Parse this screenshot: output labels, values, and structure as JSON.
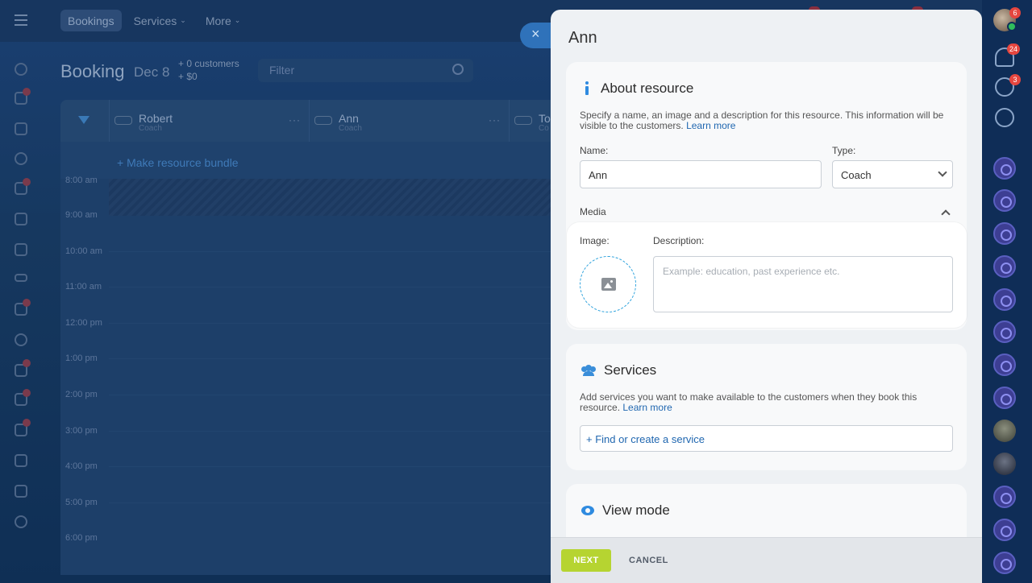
{
  "topnav": {
    "items": [
      {
        "label": "Bookings"
      },
      {
        "label": "Services"
      },
      {
        "label": "More"
      }
    ]
  },
  "booking": {
    "title": "Booking",
    "date": "Dec 8",
    "customers": "+ 0 customers",
    "amount": "+ $0",
    "filter_placeholder": "Filter"
  },
  "grid": {
    "resources": [
      {
        "name": "Robert",
        "role": "Coach"
      },
      {
        "name": "Ann",
        "role": "Coach"
      },
      {
        "name": "To",
        "role": "Co"
      }
    ],
    "bundle_link": "+ Make resource bundle",
    "times": [
      "8:00 am",
      "9:00 am",
      "10:00 am",
      "11:00 am",
      "12:00 pm",
      "1:00 pm",
      "2:00 pm",
      "3:00 pm",
      "4:00 pm",
      "5:00 pm",
      "6:00 pm"
    ]
  },
  "close_label": "×",
  "panel": {
    "title": "Ann",
    "about": {
      "title": "About resource",
      "description": "Specify a name, an image and a description for this resource. This information will be visible to the customers.",
      "learn_more": "Learn more",
      "name_label": "Name:",
      "name_value": "Ann",
      "type_label": "Type:",
      "type_value": "Coach",
      "media_label": "Media",
      "image_label": "Image:",
      "description_label": "Description:",
      "description_placeholder": "Example: education, past experience etc."
    },
    "services": {
      "title": "Services",
      "description": "Add services you want to make available to the customers when they book this resource.",
      "learn_more": "Learn more",
      "find_link": "+ Find or create a service"
    },
    "view_mode": {
      "title": "View mode"
    },
    "footer": {
      "next": "NEXT",
      "cancel": "CANCEL"
    }
  },
  "rightbar": {
    "avatar_badge": "6",
    "notifications_badge": "24",
    "activity_badge": "3"
  },
  "colors": {
    "accent": "#2067b0",
    "next_button": "#b6d431",
    "badge": "#e5463f",
    "info_icon": "#2f8be0"
  },
  "icons": [
    "menu-icon",
    "chevron-down-icon",
    "search-icon",
    "funnel-icon",
    "info-icon",
    "people-icon",
    "eye-icon",
    "image-icon",
    "chevron-up-icon",
    "bell-icon",
    "close-icon"
  ]
}
